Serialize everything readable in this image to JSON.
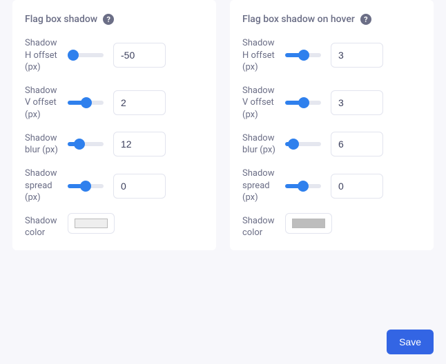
{
  "panels": {
    "left": {
      "title": "Flag box shadow",
      "help_glyph": "?",
      "rows": {
        "h_offset": {
          "label": "Shadow H offset (px)",
          "value": "-50",
          "slider_min": -50,
          "slider_max": 50,
          "slider_val": -50
        },
        "v_offset": {
          "label": "Shadow V offset (px)",
          "value": "2",
          "slider_min": -50,
          "slider_max": 50,
          "slider_val": 2
        },
        "blur": {
          "label": "Shadow blur (px)",
          "value": "12",
          "slider_min": 0,
          "slider_max": 50,
          "slider_val": 12
        },
        "spread": {
          "label": "Shadow spread (px)",
          "value": "0",
          "slider_min": -50,
          "slider_max": 50,
          "slider_val": 0
        },
        "color": {
          "label": "Shadow color",
          "swatch": "#eeeeee"
        }
      }
    },
    "right": {
      "title": "Flag box shadow on hover",
      "help_glyph": "?",
      "rows": {
        "h_offset": {
          "label": "Shadow H offset (px)",
          "value": "3",
          "slider_min": -50,
          "slider_max": 50,
          "slider_val": 3
        },
        "v_offset": {
          "label": "Shadow V offset (px)",
          "value": "3",
          "slider_min": -50,
          "slider_max": 50,
          "slider_val": 3
        },
        "blur": {
          "label": "Shadow blur (px)",
          "value": "6",
          "slider_min": 0,
          "slider_max": 50,
          "slider_val": 6
        },
        "spread": {
          "label": "Shadow spread (px)",
          "value": "0",
          "slider_min": -50,
          "slider_max": 50,
          "slider_val": 0
        },
        "color": {
          "label": "Shadow color",
          "swatch": "#bdbdbd"
        }
      }
    }
  },
  "buttons": {
    "save": "Save"
  },
  "colors": {
    "accent": "#2f80ed",
    "track_off": "#e5e7ef"
  }
}
